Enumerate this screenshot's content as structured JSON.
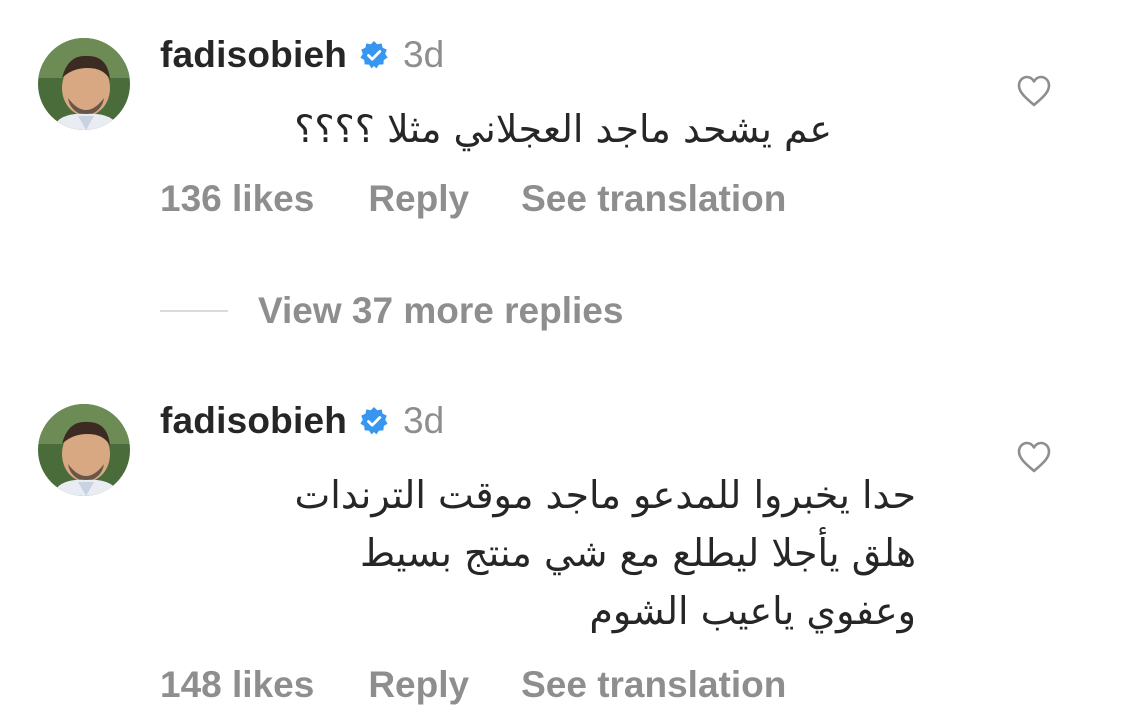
{
  "comments": [
    {
      "username": "fadisobieh",
      "timestamp": "3d",
      "text": "عم يشحد ماجد العجلاني مثلا ؟؟؟؟",
      "likes": "136 likes",
      "reply_label": "Reply",
      "translate_label": "See translation",
      "verified": true,
      "liked": false
    },
    {
      "username": "fadisobieh",
      "timestamp": "3d",
      "text": "حدا يخبروا للمدعو ماجد  موقت الترندات\nهلق  يأجلا ليطلع مع شي منتج  بسيط\nوعفوي  ياعيب الشوم",
      "likes": "148 likes",
      "reply_label": "Reply",
      "translate_label": "See translation",
      "verified": true,
      "liked": false
    }
  ],
  "view_replies": {
    "label": "View 37 more replies"
  },
  "colors": {
    "primary_text": "#262626",
    "secondary_text": "#8e8e8e",
    "verified_blue": "#3797f0",
    "divider": "#dbdbdb"
  },
  "icons": {
    "verified": "verified-badge-icon",
    "heart": "heart-outline-icon"
  }
}
